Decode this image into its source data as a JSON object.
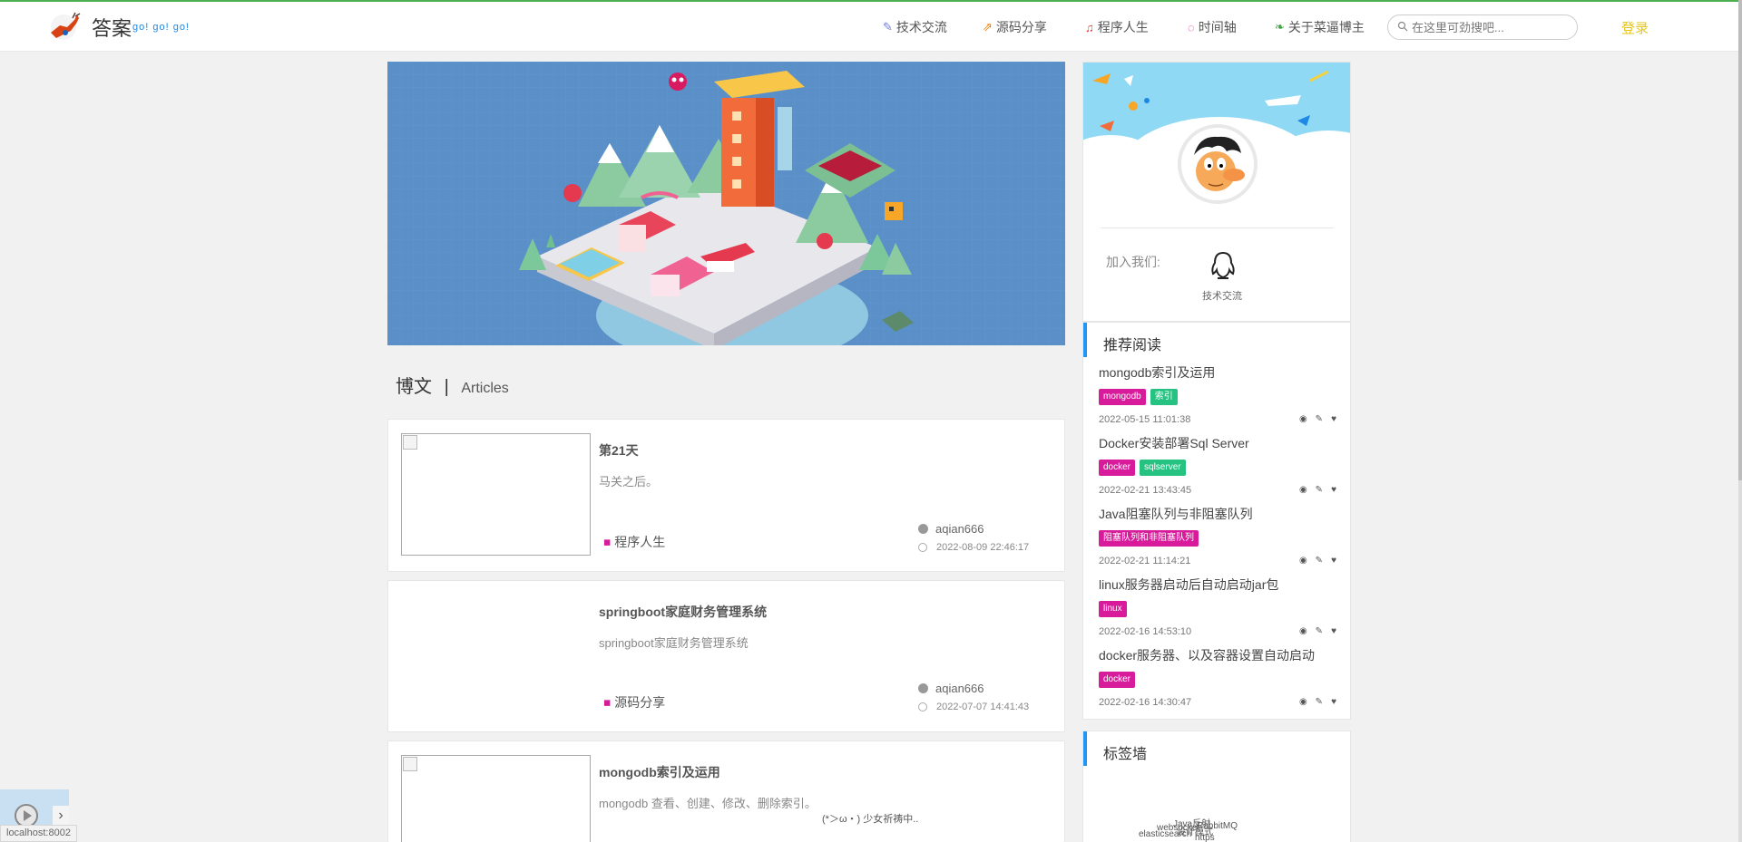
{
  "header": {
    "logo_title": "答案",
    "logo_sub": "go! go! go!",
    "nav": [
      {
        "label": "技术交流",
        "icon": "pencil-icon",
        "color": "#6a7bd8"
      },
      {
        "label": "源码分享",
        "icon": "share-icon",
        "color": "#f57c00"
      },
      {
        "label": "程序人生",
        "icon": "headphones-icon",
        "color": "#e53935"
      },
      {
        "label": "时间轴",
        "icon": "clock-icon",
        "color": "#d81b9a"
      },
      {
        "label": "关于菜逼博主",
        "icon": "leaf-icon",
        "color": "#43a047"
      }
    ],
    "search_placeholder": "在这里可劲搜吧...",
    "login": "登录"
  },
  "section": {
    "title_cn": "博文",
    "separator": "|",
    "title_en": "Articles"
  },
  "articles": [
    {
      "title": "第21天",
      "desc": "马关之后。",
      "category": "程序人生",
      "author": "aqian666",
      "date": "2022-08-09 22:46:17",
      "has_image": true
    },
    {
      "title": "springboot家庭财务管理系统",
      "desc": "springboot家庭财务管理系统",
      "category": "源码分享",
      "author": "aqian666",
      "date": "2022-07-07 14:41:43",
      "has_image": false
    },
    {
      "title": "mongodb索引及运用",
      "desc": "mongodb 查看、创建、修改、删除索引。",
      "has_image": true
    }
  ],
  "profile": {
    "join_label": "加入我们:",
    "qq_label": "技术交流"
  },
  "recommend": {
    "title": "推荐阅读",
    "items": [
      {
        "title": "mongodb索引及运用",
        "tags": [
          {
            "text": "mongodb",
            "color": "#d81b9a"
          },
          {
            "text": "索引",
            "color": "#26c281"
          }
        ],
        "date": "2022-05-15 11:01:38"
      },
      {
        "title": "Docker安装部署Sql Server",
        "tags": [
          {
            "text": "docker",
            "color": "#d81b9a"
          },
          {
            "text": "sqlserver",
            "color": "#26c281"
          }
        ],
        "date": "2022-02-21 13:43:45"
      },
      {
        "title": "Java阻塞队列与非阻塞队列",
        "tags": [
          {
            "text": "阻塞队列和非阻塞队列",
            "color": "#d81b9a"
          }
        ],
        "date": "2022-02-21 11:14:21"
      },
      {
        "title": "linux服务器启动后自动启动jar包",
        "tags": [
          {
            "text": "linux",
            "color": "#d81b9a"
          }
        ],
        "date": "2022-02-16 14:53:10"
      },
      {
        "title": "docker服务器、以及容器设置自动启动",
        "tags": [
          {
            "text": "docker",
            "color": "#d81b9a"
          }
        ],
        "date": "2022-02-16 14:30:47"
      }
    ]
  },
  "tagwall": {
    "title": "标签墙",
    "tags": [
      "Java反射",
      "websocket",
      "RabbitMQ",
      "elasticsearch",
      "设计模式",
      "https"
    ]
  },
  "status": {
    "url": "localhost:8002",
    "loading": "(*＞ω・) 少女祈祷中.."
  }
}
